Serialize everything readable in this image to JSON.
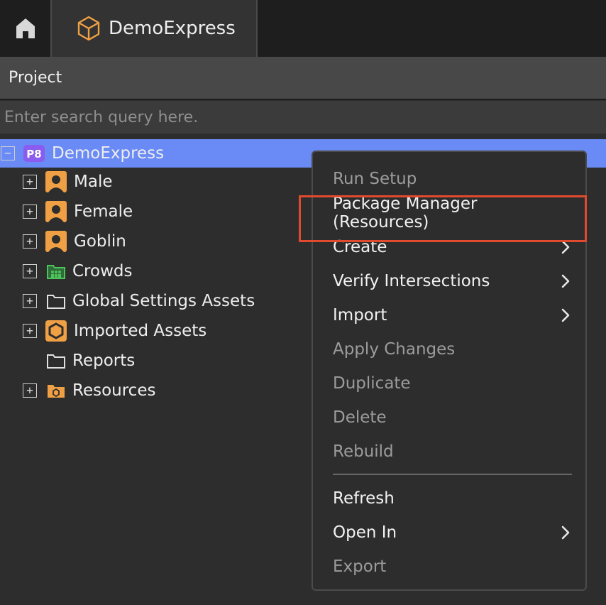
{
  "tabbar": {
    "home_icon": "home-icon",
    "tab_icon": "cube-icon",
    "tab_title": "DemoExpress"
  },
  "panel": {
    "title": "Project"
  },
  "search": {
    "placeholder": "Enter search query here."
  },
  "tree": {
    "root": {
      "icon": "p8-logo-icon",
      "logo_text": "P8",
      "label": "DemoExpress",
      "expander": "−"
    },
    "items": [
      {
        "label": "Male",
        "icon": "person-icon",
        "expander": "+"
      },
      {
        "label": "Female",
        "icon": "person-icon",
        "expander": "+"
      },
      {
        "label": "Goblin",
        "icon": "person-icon",
        "expander": "+"
      },
      {
        "label": "Crowds",
        "icon": "crowd-folder-icon",
        "expander": "+"
      },
      {
        "label": "Global Settings Assets",
        "icon": "folder-icon",
        "expander": "+"
      },
      {
        "label": "Imported Assets",
        "icon": "hexagon-icon",
        "expander": "+"
      },
      {
        "label": "Reports",
        "icon": "folder-icon",
        "expander": ""
      },
      {
        "label": "Resources",
        "icon": "resource-folder-icon",
        "expander": "+"
      }
    ]
  },
  "context_menu": {
    "items": [
      {
        "label": "Run Setup",
        "enabled": false,
        "submenu": false
      },
      {
        "label": "Package Manager (Resources)",
        "enabled": true,
        "submenu": false
      },
      {
        "label": "Create",
        "enabled": true,
        "submenu": true
      },
      {
        "label": "Verify Intersections",
        "enabled": true,
        "submenu": true
      },
      {
        "label": "Import",
        "enabled": true,
        "submenu": true
      },
      {
        "label": "Apply Changes",
        "enabled": false,
        "submenu": false
      },
      {
        "label": "Duplicate",
        "enabled": false,
        "submenu": false
      },
      {
        "label": "Delete",
        "enabled": false,
        "submenu": false
      },
      {
        "label": "Rebuild",
        "enabled": false,
        "submenu": false
      },
      {
        "label": "Refresh",
        "enabled": true,
        "submenu": false
      },
      {
        "label": "Open In",
        "enabled": true,
        "submenu": true
      },
      {
        "label": "Export",
        "enabled": false,
        "submenu": false
      }
    ]
  },
  "colors": {
    "selection": "#6a8af5",
    "accent_orange": "#f0a044",
    "highlight_box": "#e04a2e",
    "crowd_green": "#4cc45a"
  }
}
